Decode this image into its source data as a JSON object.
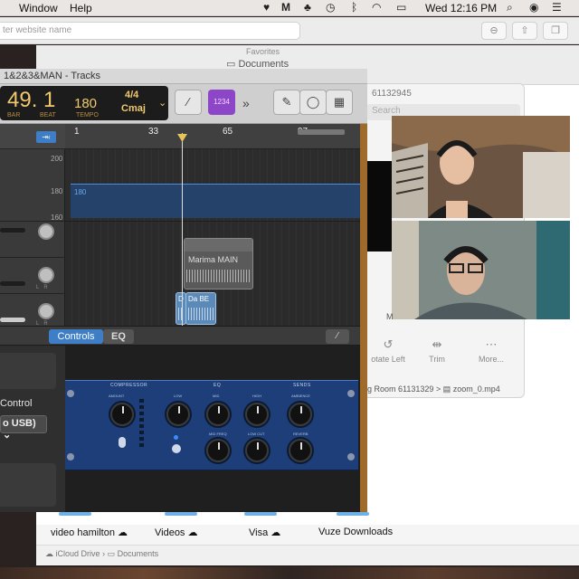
{
  "menubar": {
    "menus": [
      "Window",
      "Help"
    ],
    "clock": "Wed 12:16 PM"
  },
  "browser": {
    "url_placeholder": "ter website name"
  },
  "finder": {
    "favorites_label": "Favorites",
    "window_tab": "Documents",
    "folders": [
      "video hamilton",
      "Videos",
      "Visa",
      "Vuze Downloads"
    ],
    "path": [
      "iCloud Drive",
      "Documents"
    ]
  },
  "quicktime": {
    "meeting_id": "61132945",
    "search_placeholder": "Search",
    "tools": [
      {
        "label": "otate Left",
        "icon": "rotate-left-icon"
      },
      {
        "label": "Trim",
        "icon": "trim-icon"
      },
      {
        "label": "More...",
        "icon": "more-icon"
      }
    ],
    "file_path": "ng Room 61131329 > ",
    "file_name": "zoom_0.mp4"
  },
  "video_call": {
    "partial_label": "M"
  },
  "garageband": {
    "title": "1&2&3&MAN - Tracks",
    "lcd": {
      "position": "49. 1",
      "bar_label": "BAR",
      "beat_label": "BEAT",
      "tempo": "180",
      "tempo_label": "TEMPO",
      "signature": "4/4",
      "key": "Cmaj"
    },
    "count_in": "1234",
    "more": "»",
    "ruler": [
      "1",
      "33",
      "65",
      "97"
    ],
    "tempo_axis": [
      "200",
      "180",
      "160"
    ],
    "tempo_value": "180",
    "regions": {
      "marimba": "Marima MAIN",
      "d": "D",
      "dabe": "Da BE"
    },
    "smart_controls": {
      "tab_controls": "Controls",
      "tab_eq": "EQ",
      "control_label": "Control",
      "input_value": "o USB)",
      "plugin": {
        "sections": [
          "COMPRESSOR",
          "EQ",
          "SENDS"
        ],
        "knobs": [
          "AMOUNT",
          "LOW",
          "MID",
          "HIGH",
          "AMBIENCE",
          "MID FREQ",
          "LOW CUT",
          "REVERB"
        ]
      }
    }
  },
  "colors": {
    "lcd_text": "#f1c96c",
    "accent_blue": "#3d7ec6",
    "count_in_purple": "#8d46c8",
    "plugin_blue": "#1d3e78"
  }
}
